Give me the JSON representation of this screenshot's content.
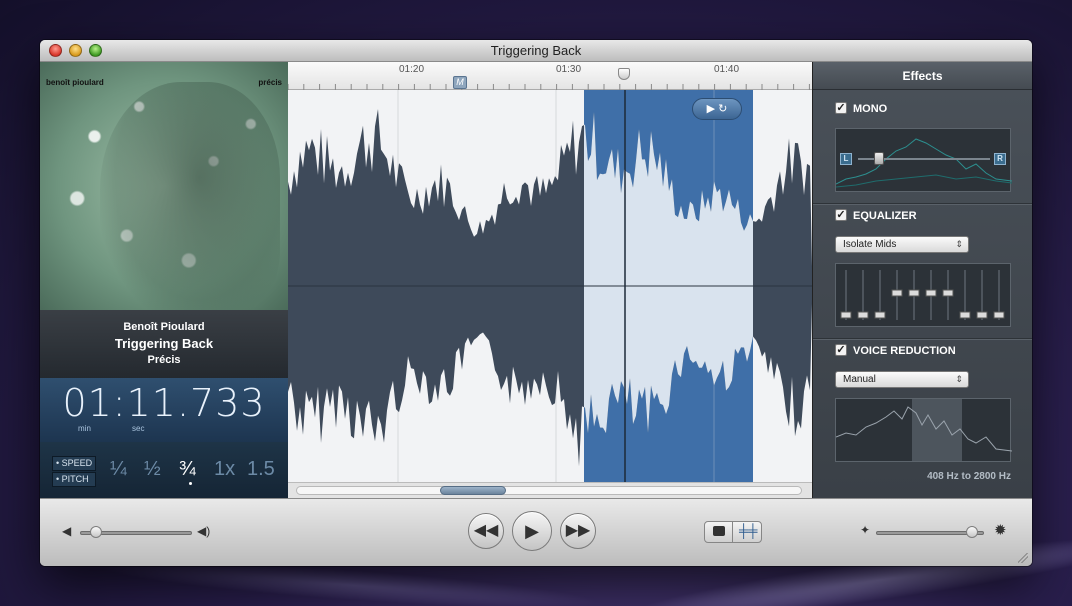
{
  "window": {
    "title": "Triggering Back"
  },
  "artwork": {
    "artist_text": "benoît pioulard",
    "album_text": "précis"
  },
  "track": {
    "artist": "Benoît Pioulard",
    "title": "Triggering Back",
    "album": "Précis"
  },
  "timer": {
    "value": "01:11.733",
    "min_label": "min",
    "sec_label": "sec"
  },
  "speed": {
    "speed_label": "• SPEED",
    "pitch_label": "• PITCH",
    "values": [
      "¼",
      "½",
      "¾",
      "1x",
      "1.5"
    ],
    "selected": "¾"
  },
  "timeline": {
    "ticks": [
      "01:20",
      "01:30",
      "01:40"
    ],
    "marker_label": "M",
    "loop_button": "▶ ↻"
  },
  "effects": {
    "title": "Effects",
    "mono": {
      "label": "MONO",
      "checked": true,
      "left": "L",
      "right": "R"
    },
    "equalizer": {
      "label": "EQUALIZER",
      "checked": true,
      "preset": "Isolate Mids"
    },
    "voice_reduction": {
      "label": "VOICE REDUCTION",
      "checked": true,
      "mode": "Manual",
      "range": "408 Hz to 2800 Hz"
    }
  },
  "colors": {
    "selection": "#3f6fa8",
    "wave": "#3e4a5a",
    "accent": "#2f4f6f"
  },
  "icons": [
    "close-icon",
    "minimize-icon",
    "zoom-icon",
    "volume-low-icon",
    "volume-high-icon",
    "rewind-icon",
    "play-icon",
    "fast-forward-icon",
    "speech-icon",
    "equalizer-icon",
    "wave-small-icon",
    "wave-large-icon"
  ]
}
